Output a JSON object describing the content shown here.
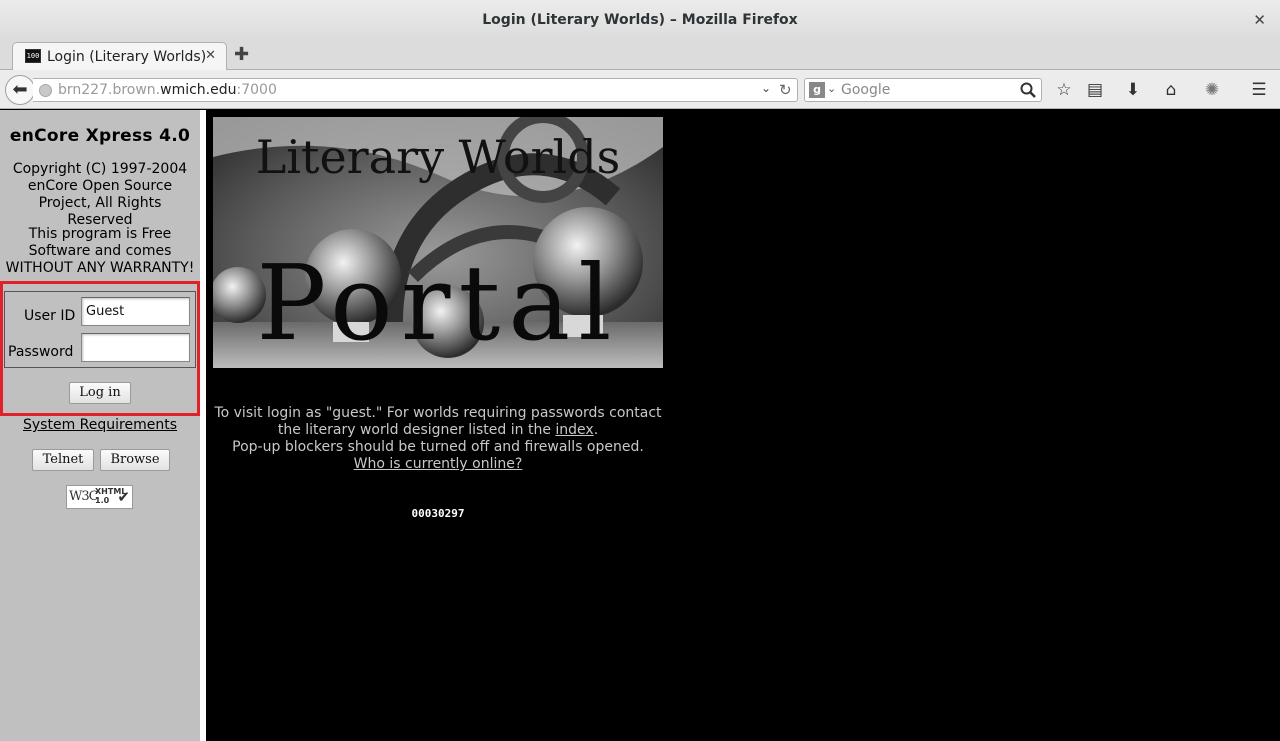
{
  "window": {
    "title": "Login (Literary Worlds) – Mozilla Firefox",
    "close_glyph": "✕"
  },
  "tabs": [
    {
      "label": "Login (Literary Worlds)",
      "favicon_text": "100",
      "close_glyph": "✕"
    }
  ],
  "new_tab_glyph": "✚",
  "navbar": {
    "back_glyph": "⬅",
    "url_prefix": "brn227.brown.",
    "url_domain": "wmich.edu",
    "url_suffix": ":7000",
    "dropdown_glyph": "⌄",
    "reload_glyph": "↻",
    "search": {
      "engine_glyph": "g",
      "engine_arrow": "⌄",
      "placeholder": "Google"
    },
    "toolbar": {
      "bookmark_glyph": "☆",
      "reading_list_glyph": "▤",
      "downloads_glyph": "⬇",
      "home_glyph": "⌂",
      "addon_glyph": "✺",
      "menu_glyph": "☰"
    }
  },
  "left_frame": {
    "app_title": "enCore Xpress 4.0",
    "copyright": "Copyright (C) 1997-2004 enCore Open Source Project, All Rights Reserved",
    "license": "This program is Free Software and comes WITHOUT ANY WARRANTY!",
    "login": {
      "user_label": "User ID",
      "user_value": "Guest",
      "password_label": "Password",
      "password_value": "",
      "login_button": "Log in"
    },
    "system_requirements": "System Requirements",
    "telnet_button": "Telnet",
    "browse_button": "Browse",
    "badge": {
      "w3c": "W3C",
      "xhtml": "XHTML",
      "version": "1.0",
      "check_glyph": "✔"
    }
  },
  "right_frame": {
    "banner": {
      "line1": "Literary Worlds",
      "line2": "Portal"
    },
    "caption": {
      "line1": "To visit login as \"guest.\" For worlds requiring passwords contact",
      "line2_prefix": "the literary world designer listed in the ",
      "index_link": "index",
      "line2_suffix": ".",
      "line3": "Pop-up blockers should be turned off and firewalls opened.",
      "online_link": "Who is currently online?"
    },
    "counter": "00030297"
  }
}
